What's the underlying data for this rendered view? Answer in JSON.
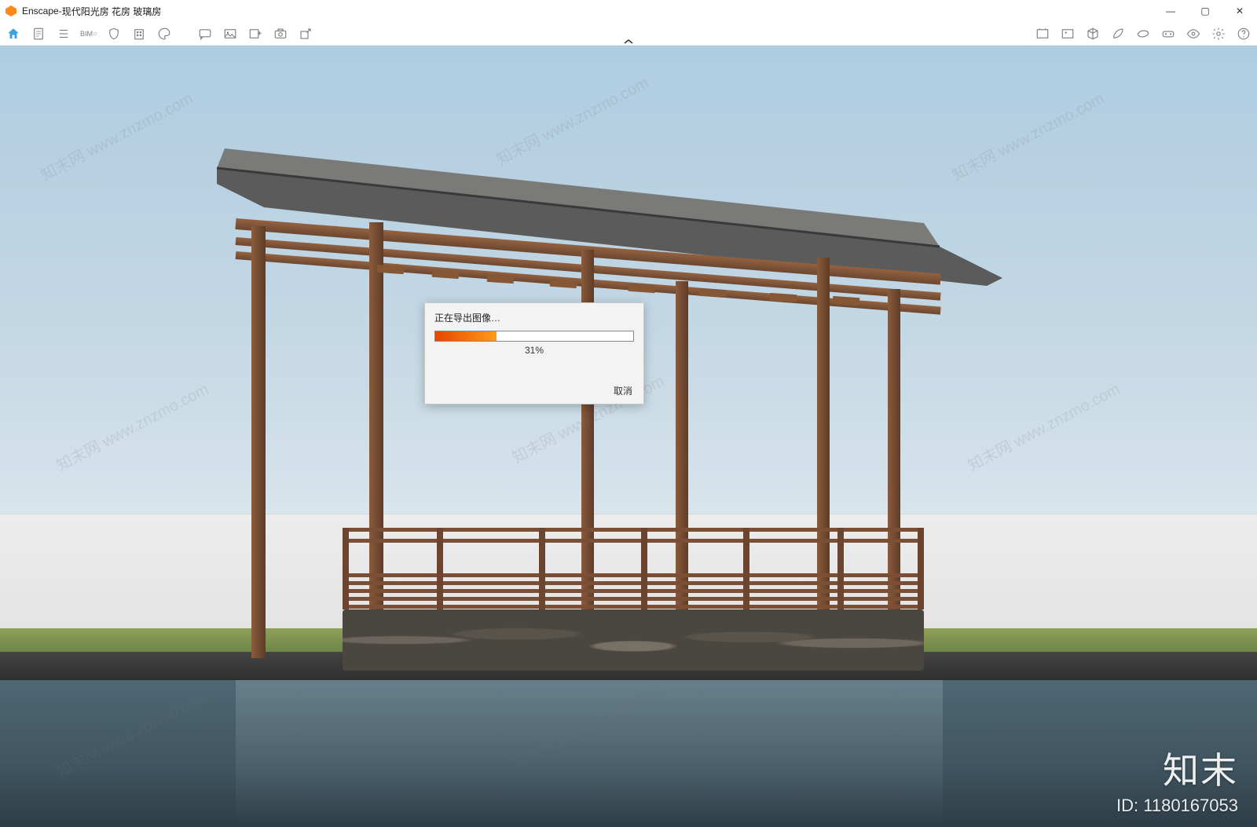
{
  "app": {
    "name": "Enscape",
    "title_separator": " - ",
    "document_title": "现代阳光房 花房 玻璃房"
  },
  "window_controls": {
    "minimize": "—",
    "maximize": "▢",
    "close": "✕"
  },
  "toolbar": {
    "left": [
      {
        "name": "home-icon"
      },
      {
        "name": "document-icon"
      },
      {
        "name": "list-icon"
      },
      {
        "name": "bim-icon",
        "label": "BIM"
      },
      {
        "name": "shield-icon"
      },
      {
        "name": "building-icon"
      },
      {
        "name": "palette-icon"
      },
      {
        "name": "message-icon"
      },
      {
        "name": "image-icon"
      },
      {
        "name": "image-add-icon"
      },
      {
        "name": "camera-icon"
      },
      {
        "name": "export-icon"
      }
    ],
    "right": [
      {
        "name": "screenshot-icon"
      },
      {
        "name": "photo-icon"
      },
      {
        "name": "cube-icon"
      },
      {
        "name": "leaf-icon"
      },
      {
        "name": "wing-icon"
      },
      {
        "name": "vr-icon"
      },
      {
        "name": "eye-icon"
      },
      {
        "name": "settings-icon"
      },
      {
        "name": "help-icon"
      }
    ]
  },
  "dialog": {
    "title": "正在导出图像…",
    "progress_percent": 31,
    "progress_label": "31%",
    "cancel_label": "取消"
  },
  "watermark": {
    "brand": "知末",
    "id_prefix": "ID: ",
    "id_value": "1180167053",
    "diag_text": "知末网 www.znzmo.com"
  },
  "colors": {
    "accent_orange_start": "#e64600",
    "accent_orange_end": "#ff9a1a",
    "toolbar_icon": "#7d7d7d",
    "active_icon": "#3fa0de"
  }
}
